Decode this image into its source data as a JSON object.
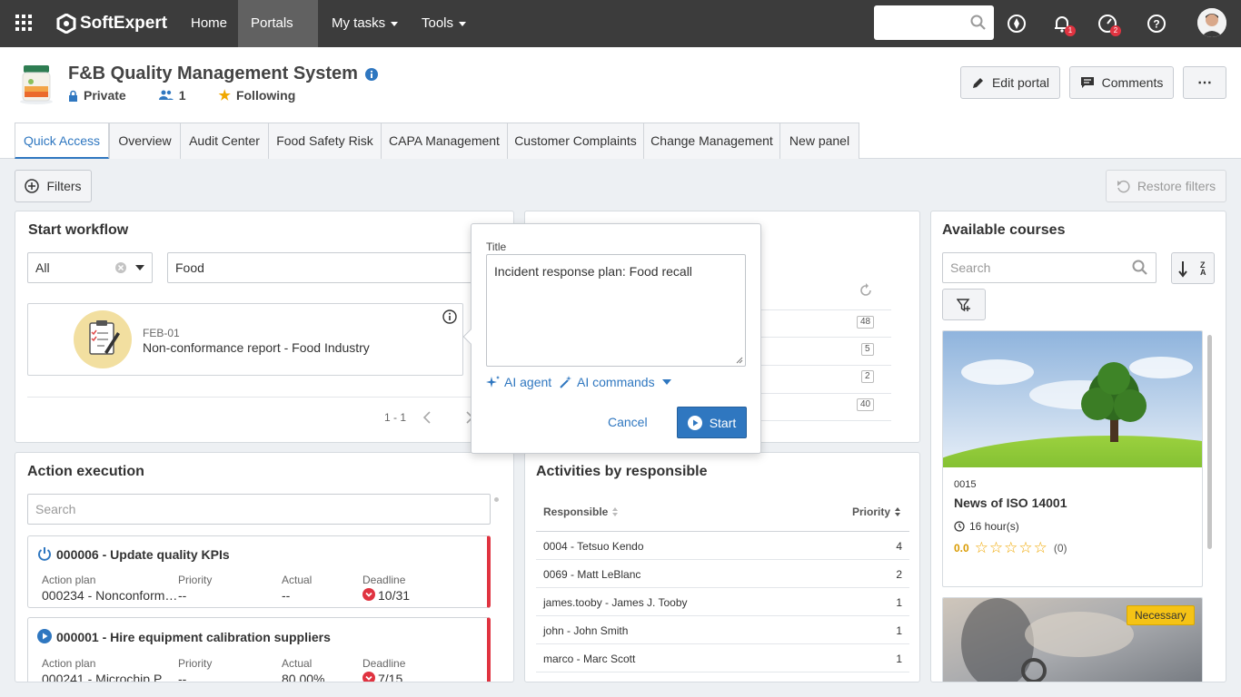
{
  "topbar": {
    "brand": "SoftExpert",
    "nav": [
      {
        "label": "Home"
      },
      {
        "label": "Portals"
      },
      {
        "label": "My tasks"
      },
      {
        "label": "Tools"
      }
    ],
    "notif_badge": "1",
    "approvals_badge": "2"
  },
  "header": {
    "title": "F&B Quality Management System",
    "privacy": "Private",
    "members": "1",
    "following": "Following",
    "edit_label": "Edit portal",
    "comments_label": "Comments",
    "more_label": "⋯"
  },
  "tabs": [
    {
      "label": "Quick Access"
    },
    {
      "label": "Overview"
    },
    {
      "label": "Audit Center"
    },
    {
      "label": "Food Safety Risk"
    },
    {
      "label": "CAPA Management"
    },
    {
      "label": "Customer Complaints"
    },
    {
      "label": "Change Management"
    },
    {
      "label": "New panel"
    }
  ],
  "toolbar": {
    "filters_label": "Filters",
    "restore_label": "Restore filters"
  },
  "start_workflow": {
    "title": "Start workflow",
    "type_select": "All",
    "search_value": "Food",
    "item": {
      "code": "FEB-01",
      "name": "Non-conformance report - Food Industry"
    },
    "pagination": "1 - 1"
  },
  "hidden_panel": {
    "counts": [
      "48",
      "5",
      "2",
      "40"
    ]
  },
  "popover": {
    "title_label": "Title",
    "title_value": "Incident response plan: Food recall",
    "ai_agent": "AI agent",
    "ai_commands": "AI commands",
    "cancel": "Cancel",
    "start": "Start"
  },
  "action_execution": {
    "title": "Action execution",
    "search_placeholder": "Search",
    "cards": [
      {
        "title": "000006 - Update quality KPIs",
        "labels": {
          "plan": "Action plan",
          "priority": "Priority",
          "actual": "Actual",
          "deadline": "Deadline"
        },
        "plan": "000234 - Nonconform…",
        "priority": "--",
        "actual": "--",
        "deadline": "10/31"
      },
      {
        "title": "000001 - Hire equipment calibration suppliers",
        "labels": {
          "plan": "Action plan",
          "priority": "Priority",
          "actual": "Actual",
          "deadline": "Deadline"
        },
        "plan": "000241 - Microchip P…",
        "priority": "--",
        "actual": "80.00%",
        "deadline": "7/15"
      }
    ]
  },
  "activities": {
    "title": "Activities by responsible",
    "col_responsible": "Responsible",
    "col_priority": "Priority",
    "rows": [
      {
        "name": "0004 - Tetsuo Kendo",
        "priority": "4"
      },
      {
        "name": "0069 - Matt LeBlanc",
        "priority": "2"
      },
      {
        "name": "james.tooby - James J. Tooby",
        "priority": "1"
      },
      {
        "name": "john - John Smith",
        "priority": "1"
      },
      {
        "name": "marco - Marc Scott",
        "priority": "1"
      }
    ]
  },
  "courses": {
    "title": "Available courses",
    "search_placeholder": "Search",
    "sort_label": "Z A",
    "course1": {
      "code": "0015",
      "name": "News of ISO 14001",
      "duration": "16 hour(s)",
      "rating": "0.0",
      "stars": 0,
      "reviews": "(0)"
    },
    "course2": {
      "tag": "Necessary"
    }
  },
  "colors": {
    "accent": "#2f77c0",
    "topbar": "#3c3c3c",
    "alert": "#e03340",
    "warning": "#f5c316"
  }
}
